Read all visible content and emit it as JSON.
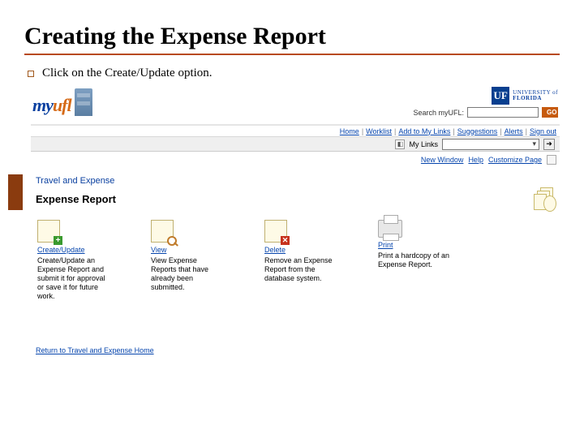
{
  "slide": {
    "title": "Creating the Expense Report",
    "bullet": "Click on the Create/Update option."
  },
  "header": {
    "logo_prefix": "my",
    "logo_suffix": "ufl",
    "uf_mark": "UF",
    "uf_line1": "UNIVERSITY of",
    "uf_line2": "FLORIDA",
    "search_label": "Search myUFL:",
    "go": "GO"
  },
  "nav": {
    "items": [
      "Home",
      "Worklist",
      "Add to My Links",
      "Suggestions",
      "Alerts",
      "Sign out"
    ]
  },
  "crumb": {
    "label": "My Links",
    "selected": ""
  },
  "util": {
    "items": [
      "New Window",
      "Help",
      "Customize Page"
    ]
  },
  "section": {
    "breadcrumb": "Travel and Expense",
    "title": "Expense Report"
  },
  "actions": [
    {
      "title": "Create/Update",
      "desc": "Create/Update an Expense Report and submit it for approval or save it for future work."
    },
    {
      "title": "View",
      "desc": "View Expense Reports that have already been submitted."
    },
    {
      "title": "Delete",
      "desc": "Remove an Expense Report from the database system."
    },
    {
      "title": "Print",
      "desc": "Print a hardcopy of an Expense Report."
    }
  ],
  "return_link": "Return to Travel and Expense Home"
}
